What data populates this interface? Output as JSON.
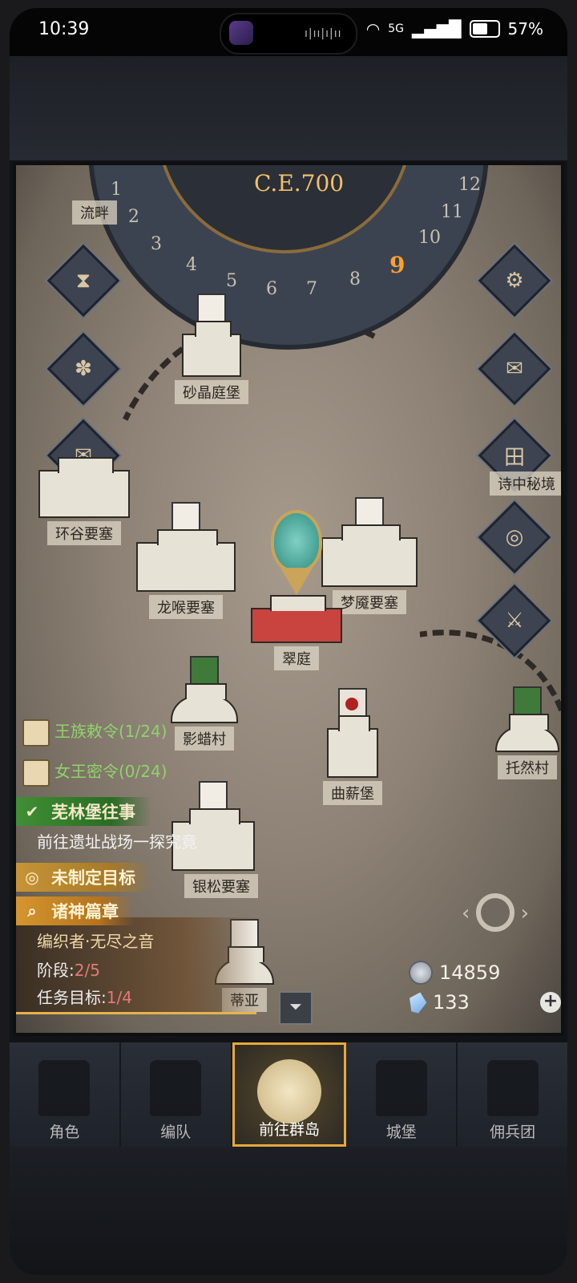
{
  "status_bar": {
    "time": "10:39",
    "network": "5G",
    "battery": "57%",
    "battery_level": 0.57
  },
  "map": {
    "year": "C.E.700",
    "months": [
      "1",
      "2",
      "3",
      "4",
      "5",
      "6",
      "7",
      "8",
      "9",
      "10",
      "11",
      "12"
    ],
    "active_month": "9",
    "locations": [
      {
        "label": "流畔"
      },
      {
        "label": "砂晶庭堡"
      },
      {
        "label": "环谷要塞"
      },
      {
        "label": "龙喉要塞"
      },
      {
        "label": "梦魇要塞"
      },
      {
        "label": "翠庭"
      },
      {
        "label": "诗中秘境"
      },
      {
        "label": "影蜡村"
      },
      {
        "label": "曲薪堡"
      },
      {
        "label": "托然村"
      },
      {
        "label": "银松要塞"
      },
      {
        "label": "蒂亚"
      }
    ],
    "left_buttons": [
      {
        "icon": "hourglass-icon",
        "glyph": "⧗"
      },
      {
        "icon": "bag-icon",
        "glyph": "✽"
      },
      {
        "icon": "scroll-icon",
        "glyph": "✉"
      }
    ],
    "right_buttons": [
      {
        "icon": "gear-icon",
        "glyph": "⚙"
      },
      {
        "icon": "mail-icon",
        "glyph": "✉"
      },
      {
        "icon": "gate-icon",
        "glyph": "田"
      },
      {
        "icon": "coin-icon",
        "glyph": "◎"
      },
      {
        "icon": "knight-icon",
        "glyph": "⚔"
      }
    ]
  },
  "quests": {
    "royal_decree": "王族敕令(1/24)",
    "queen_order": "女王密令(0/24)",
    "story_title": "芜林堡往事",
    "story_desc": "前往遗址战场一探究竟",
    "goal_title": "未制定目标",
    "chapter_title": "诸神篇章",
    "chapter_name": "编织者·无尽之音",
    "stage_label": "阶段:",
    "stage_value": "2/5",
    "task_label": "任务目标:",
    "task_value": "1/4"
  },
  "currency": {
    "silver": "14859",
    "crystal": "133"
  },
  "nav": [
    {
      "label": "角色",
      "icon": "character-icon"
    },
    {
      "label": "编队",
      "icon": "formation-icon"
    },
    {
      "label": "前往群岛",
      "icon": "islands-icon"
    },
    {
      "label": "城堡",
      "icon": "castle-icon"
    },
    {
      "label": "佣兵团",
      "icon": "mercenary-icon"
    }
  ]
}
